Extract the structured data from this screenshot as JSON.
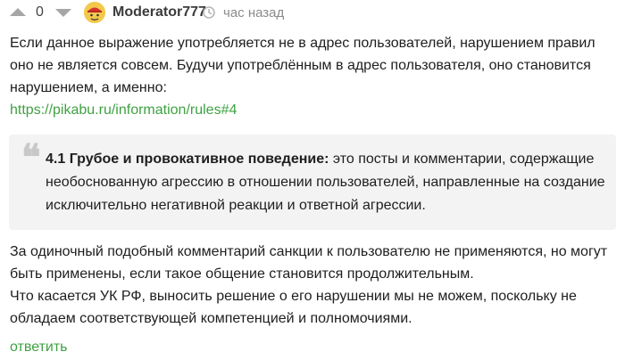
{
  "header": {
    "vote_count": "0",
    "username": "Moderator777",
    "time": "час назад"
  },
  "body": {
    "paragraph_1": "Если данное выражение употребляется не в адрес пользователей, нарушением правил оно не является совсем. Будучи употреблённым в адрес пользователя, оно становится нарушением, а именно:",
    "link": "https://pikabu.ru/information/rules#4"
  },
  "quote": {
    "bold": "4.1 Грубое и провокативное поведение:",
    "text": " это посты и комментарии, содержащие необоснованную агрессию в отношении пользователей, направленные на создание исключительно негативной реакции и ответной агрессии."
  },
  "body2": {
    "paragraph_2": "За одиночный подобный комментарий санкции к пользователю не применяются, но могут быть применены, если такое общение становится продолжительным.",
    "paragraph_3": "Что касается УК РФ, выносить решение о его нарушении мы не можем, поскольку не обладаем соответствующей компетенцией и полномочиями."
  },
  "actions": {
    "reply": "ответить"
  },
  "icons": {
    "vote_up": "triangle-up-icon",
    "vote_down": "triangle-down-icon",
    "avatar": "moderator-avatar",
    "clock": "clock-icon"
  },
  "colors": {
    "link": "#3fa142",
    "quote_bg": "#f3f3f3",
    "vote_arrows": "#a6a6a6"
  }
}
